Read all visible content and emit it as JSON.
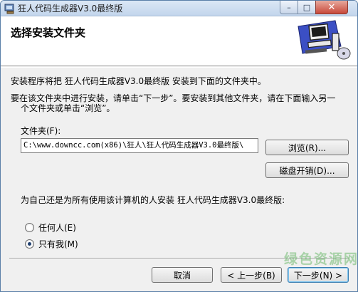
{
  "window": {
    "title": "狂人代码生成器V3.0最终版",
    "controls": {
      "minimize": "–",
      "maximize": "□",
      "close": "✕"
    }
  },
  "header": {
    "title": "选择安装文件夹",
    "art_icon": "computer-install-icon"
  },
  "body": {
    "line1": "安装程序将把 狂人代码生成器V3.0最终版 安装到下面的文件夹中。",
    "line2": "要在该文件夹中进行安装，请单击“下一步”。要安装到其他文件夹，请在下面输入另一",
    "line3": "个文件夹或单击“浏览”。",
    "folder_label": "文件夹(F):",
    "folder_value": "C:\\www.downcc.com(x86)\\狂人\\狂人代码生成器V3.0最终版\\",
    "browse_label": "浏览(R)...",
    "disk_label": "磁盘开销(D)...",
    "who_label": "为自己还是为所有使用该计算机的人安装 狂人代码生成器V3.0最终版:",
    "options": [
      {
        "label": "任何人(E)",
        "checked": false
      },
      {
        "label": "只有我(M)",
        "checked": true
      }
    ]
  },
  "footer": {
    "cancel_label": "取消",
    "prev_label": "< 上一步(B)",
    "next_label": "下一步(N) >"
  },
  "watermark": "绿色资源网",
  "colors": {
    "accent": "#3c7fb1",
    "chrome": "#c2d5ec",
    "close": "#c8483a"
  }
}
